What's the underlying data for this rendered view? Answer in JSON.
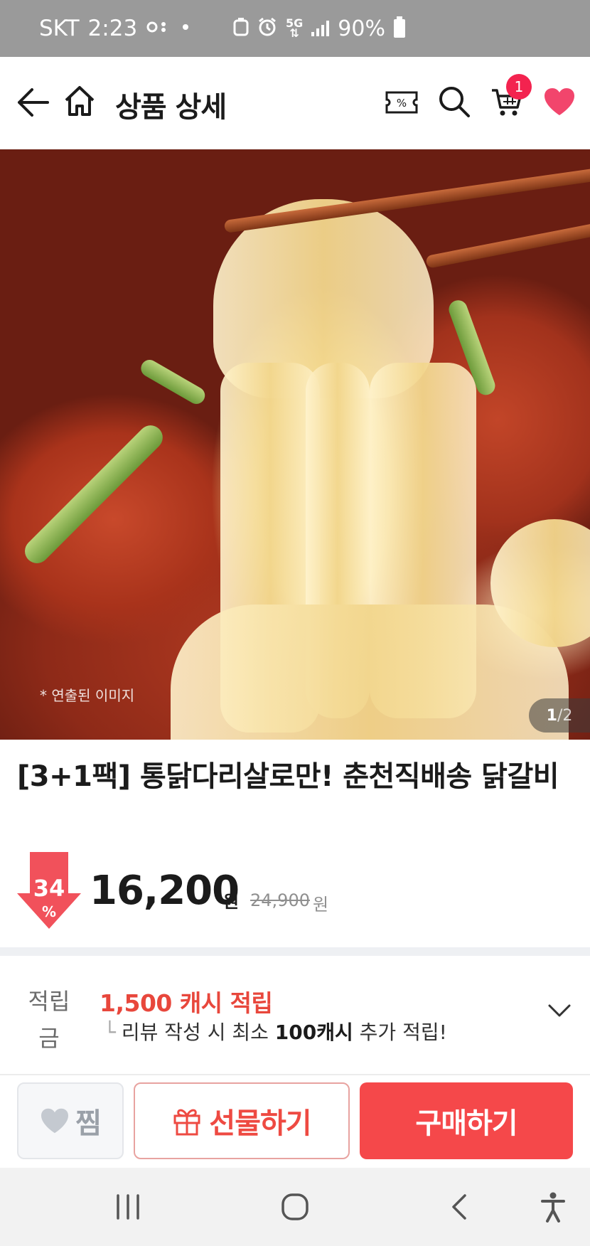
{
  "status_bar": {
    "carrier": "SKT",
    "time": "2:23",
    "network": "5G",
    "battery": "90%"
  },
  "header": {
    "title": "상품 상세",
    "cart_count": "1",
    "coupon_icon_text": "%"
  },
  "hero": {
    "caption": "* 연출된 이미지",
    "page_current": "1",
    "page_total": "/2"
  },
  "product": {
    "title": "[3+1팩] 통닭다리살로만! 춘천직배송 닭갈비",
    "discount_percent": "34",
    "discount_sign": "%",
    "price": "16,200",
    "price_unit": "원",
    "original_price": "24,900",
    "original_unit": "원"
  },
  "points": {
    "label": "적립금",
    "main": "1,500 캐시 적립",
    "sub_prefix": "리뷰 작성 시 최소 ",
    "sub_bold": "100캐시",
    "sub_suffix": " 추가 적립!"
  },
  "actions": {
    "wish_label": "찜",
    "gift_label": "선물하기",
    "buy_label": "구매하기"
  },
  "colors": {
    "accent_red": "#f5484a",
    "badge_pink": "#f3234f",
    "heart_pink": "#f2456c",
    "points_red": "#e8473c"
  }
}
